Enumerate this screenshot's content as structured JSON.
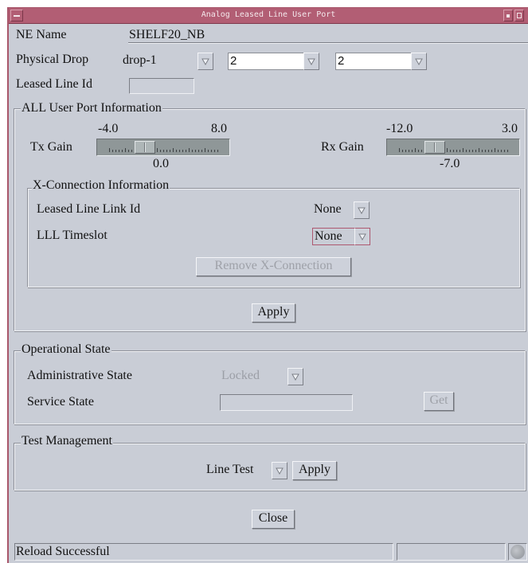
{
  "window": {
    "title": "Analog Leased Line User Port"
  },
  "ne_name": {
    "label": "NE Name",
    "value": "SHELF20_NB"
  },
  "physical_drop": {
    "label": "Physical Drop",
    "drop_value": "drop-1",
    "slot_value": "2",
    "port_value": "2"
  },
  "leased_line_id": {
    "label": "Leased Line Id",
    "value": ""
  },
  "all_user_port": {
    "title": "ALL User Port Information",
    "tx_gain": {
      "label": "Tx Gain",
      "min_label": "-4.0",
      "max_label": "8.0",
      "min": -4.0,
      "max": 8.0,
      "value_label": "0.0",
      "value": 0.0
    },
    "rx_gain": {
      "label": "Rx Gain",
      "min_label": "-12.0",
      "max_label": "3.0",
      "min": -12.0,
      "max": 3.0,
      "value_label": "-7.0",
      "value": -7.0
    },
    "x_connection": {
      "title": "X-Connection Information",
      "link_id_label": "Leased Line Link Id",
      "link_id_value": "None",
      "timeslot_label": "LLL Timeslot",
      "timeslot_value": "None",
      "remove_button": "Remove X-Connection"
    },
    "apply_button": "Apply"
  },
  "operational_state": {
    "title": "Operational State",
    "admin_label": "Administrative State",
    "admin_value": "Locked",
    "service_label": "Service State",
    "service_value": "",
    "get_button": "Get"
  },
  "test_management": {
    "title": "Test Management",
    "test_value": "Line Test",
    "apply_button": "Apply"
  },
  "close_button": "Close",
  "status_bar": {
    "message": "Reload Successful",
    "secondary": ""
  },
  "colors": {
    "titlebar": "#b25e74",
    "dialog_bg": "#c9cdd6",
    "slider_trough": "#8f9798"
  }
}
